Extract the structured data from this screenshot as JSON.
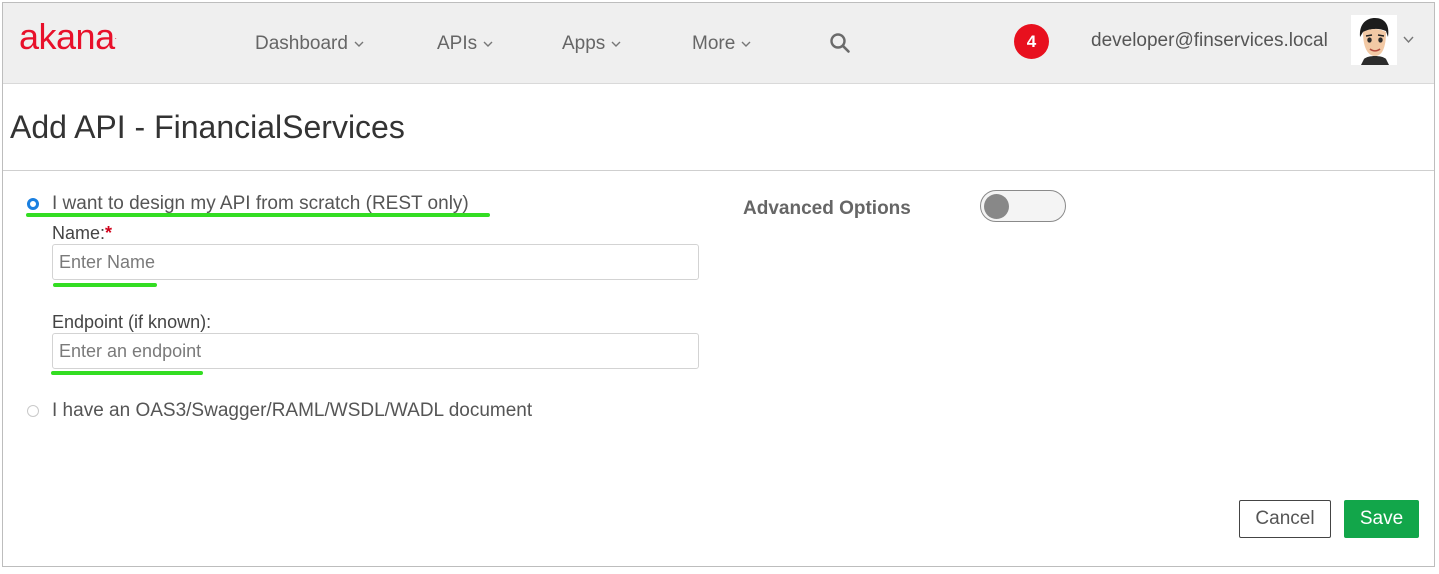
{
  "header": {
    "logo_text": "akana",
    "logo_tm": ".",
    "nav": [
      {
        "label": "Dashboard"
      },
      {
        "label": "APIs"
      },
      {
        "label": "Apps"
      },
      {
        "label": "More"
      }
    ],
    "notification_count": "4",
    "user_email": "developer@finservices.local"
  },
  "page": {
    "title": "Add API - FinancialServices"
  },
  "form": {
    "option_scratch_label": "I want to design my API from scratch (REST only)",
    "name_label": "Name:",
    "name_required_mark": "*",
    "name_placeholder": "Enter Name",
    "name_value": "",
    "endpoint_label": "Endpoint (if known):",
    "endpoint_placeholder": "Enter an endpoint",
    "endpoint_value": "",
    "option_document_label": "I have an OAS3/Swagger/RAML/WSDL/WADL document",
    "selected_option": "scratch"
  },
  "advanced": {
    "label": "Advanced Options",
    "enabled": false
  },
  "actions": {
    "cancel_label": "Cancel",
    "save_label": "Save"
  },
  "colors": {
    "brand": "#e8102a",
    "accent": "#1a7fe0",
    "save": "#12a64a",
    "highlight": "#33dd22",
    "badge": "#e8101e"
  }
}
